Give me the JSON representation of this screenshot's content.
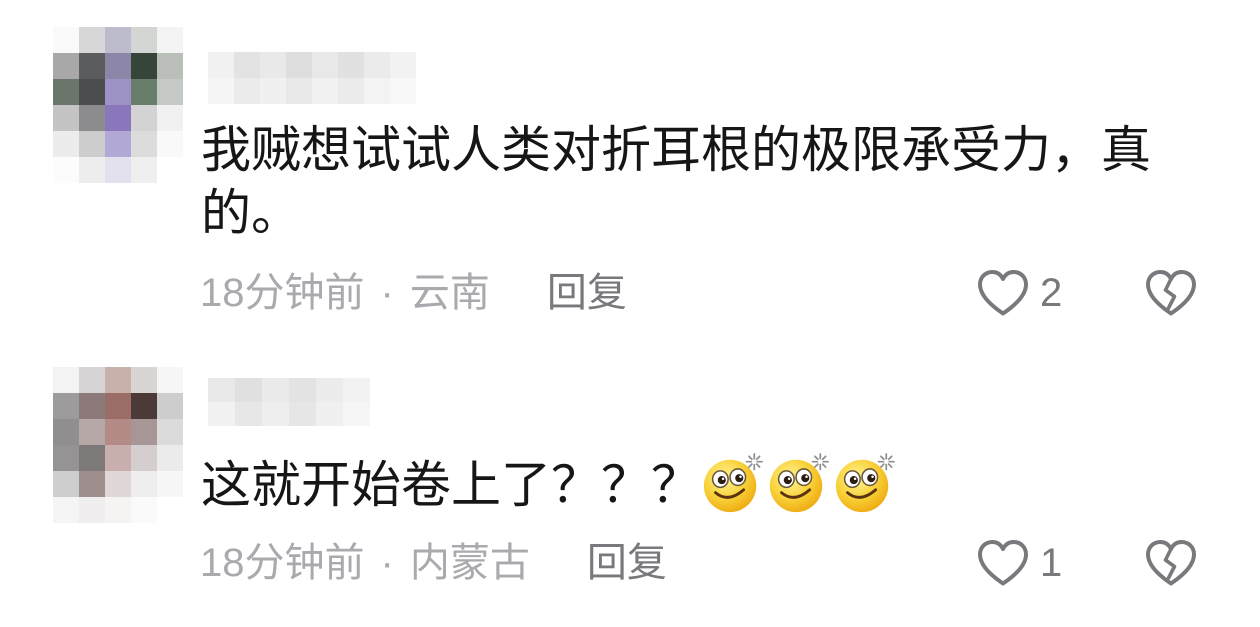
{
  "colors": {
    "bg": "#ffffff",
    "text": "#161616",
    "meta": "#a9a9ae",
    "action": "#78787d"
  },
  "icons": {
    "like": "heart-icon",
    "dislike": "broken-heart-icon"
  },
  "comments": [
    {
      "avatar_mosaic": [
        [
          "#fafafa",
          "#d7d7d7",
          "#bdbccc",
          "#d3d6d2",
          "#f4f4f4"
        ],
        [
          "#a8a8a8",
          "#5b5c5e",
          "#8c87a8",
          "#37443a",
          "#b9beb9"
        ],
        [
          "#6a756b",
          "#4c4d4e",
          "#9c92c6",
          "#687d6a",
          "#c5c9c5"
        ],
        [
          "#c4c4c4",
          "#8c8c8e",
          "#8976bb",
          "#d3d3d3",
          "#f1f1f1"
        ],
        [
          "#ececec",
          "#cdcdcd",
          "#b2a8d6",
          "#dcdcdc",
          "#f9f9f9"
        ],
        [
          "#fcfcfc",
          "#ededed",
          "#e4e1ee",
          "#efefef",
          "#ffffff"
        ]
      ],
      "username_mosaic": [
        [
          "#f1f1f1",
          "#e3e3e3",
          "#e9e9e9",
          "#dedede",
          "#e8e8e8",
          "#e1e1e1",
          "#ebebeb",
          "#f2f2f2"
        ],
        [
          "#f5f5f5",
          "#ebebeb",
          "#f0f0f0",
          "#e9e9e9",
          "#f1f1f1",
          "#ebebeb",
          "#f3f3f3",
          "#f8f8f8"
        ]
      ],
      "text": "我贼想试试人类对折耳根的极限承受力，真的。",
      "time": "18分钟前",
      "separator": "·",
      "location": "云南",
      "reply_label": "回复",
      "likes": 2
    },
    {
      "avatar_mosaic": [
        [
          "#f3f3f3",
          "#d6d4d4",
          "#c8b1aa",
          "#d9d5d4",
          "#f6f6f6"
        ],
        [
          "#9d9b9c",
          "#8b7a79",
          "#9c6c66",
          "#4b3a37",
          "#cdcdcd"
        ],
        [
          "#908e8f",
          "#b7a8a8",
          "#b38a86",
          "#a79696",
          "#dbdbdb"
        ],
        [
          "#959393",
          "#7e7979",
          "#c8afad",
          "#d5cece",
          "#ebebeb"
        ],
        [
          "#cecece",
          "#9f8e8e",
          "#e0d8d8",
          "#eeeeee",
          "#f7f7f7"
        ],
        [
          "#f5f5f5",
          "#efeded",
          "#f6f3f3",
          "#fafafa",
          "#ffffff"
        ]
      ],
      "username_mosaic": [
        [
          "#e9e9e9",
          "#e0e0e0",
          "#eaeaea",
          "#e3e3e3",
          "#ececec",
          "#f2f2f2"
        ],
        [
          "#f1f1f1",
          "#e7e7e7",
          "#eeeeee",
          "#e6e6e6",
          "#f0f0f0",
          "#f6f6f6"
        ]
      ],
      "text": "这就开始卷上了？？？",
      "emojis": [
        "sparkle-eyes-smile-emoji",
        "sparkle-eyes-smile-emoji",
        "sparkle-eyes-smile-emoji"
      ],
      "time": "18分钟前",
      "separator": "·",
      "location": "内蒙古",
      "reply_label": "回复",
      "likes": 1
    }
  ]
}
